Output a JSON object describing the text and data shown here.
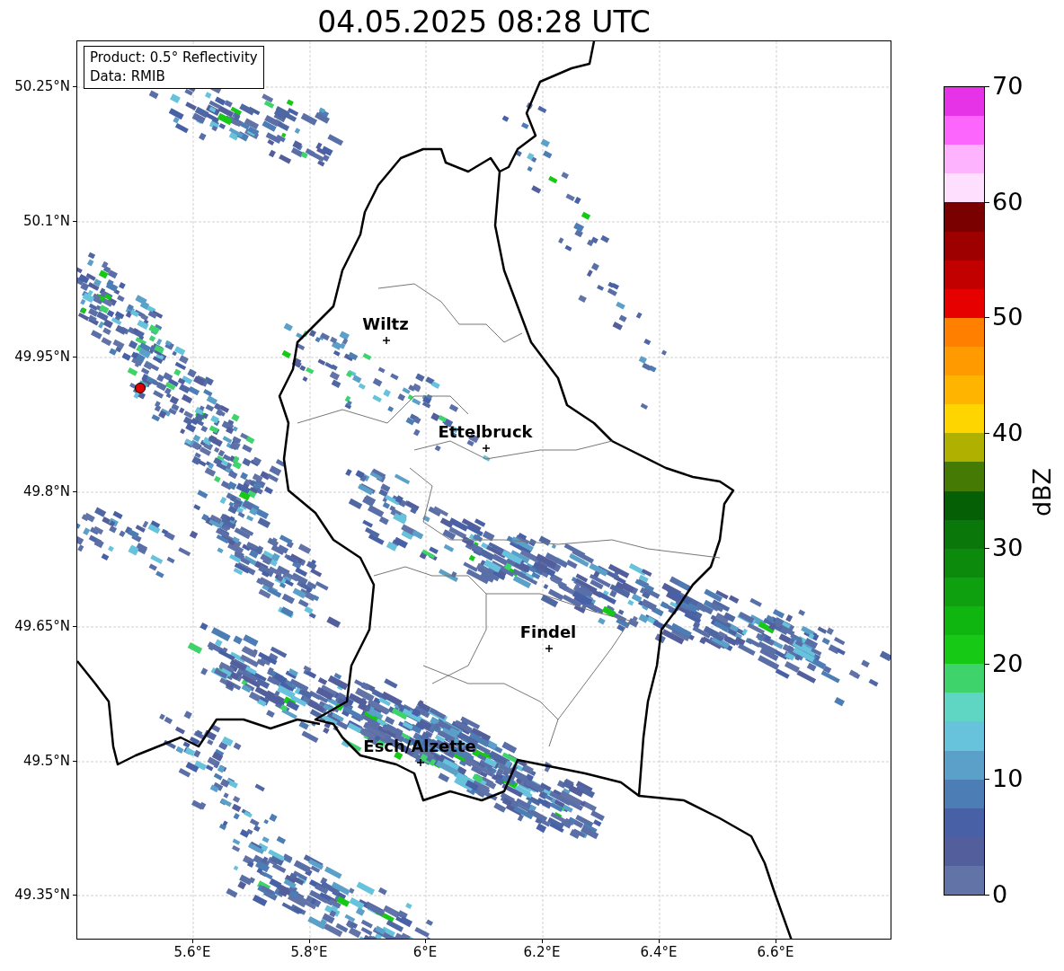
{
  "title": "04.05.2025 08:28 UTC",
  "info_box": [
    "Product: 0.5° Reflectivity",
    "Data: RMIB"
  ],
  "lat_labels": [
    "50.25°N",
    "50.1°N",
    "49.95°N",
    "49.8°N",
    "49.65°N",
    "49.5°N",
    "49.35°N"
  ],
  "lon_labels": [
    "5.6°E",
    "5.8°E",
    "6°E",
    "6.2°E",
    "6.4°E",
    "6.6°E"
  ],
  "cities": [
    {
      "name": "Wiltz"
    },
    {
      "name": "Ettelbruck"
    },
    {
      "name": "Findel"
    },
    {
      "name": "Esch/Alzette"
    }
  ],
  "colorbar": {
    "label": "dBZ",
    "ticks": [
      "70",
      "60",
      "50",
      "40",
      "30",
      "20",
      "10",
      "0"
    ],
    "segments": [
      {
        "color": "#e733e7"
      },
      {
        "color": "#fd66fd"
      },
      {
        "color": "#fdb3fd"
      },
      {
        "color": "#fee0fe"
      },
      {
        "color": "#7a0000"
      },
      {
        "color": "#9e0000"
      },
      {
        "color": "#c20000"
      },
      {
        "color": "#e60000"
      },
      {
        "color": "#ff7f00"
      },
      {
        "color": "#ff9a00"
      },
      {
        "color": "#ffb400"
      },
      {
        "color": "#ffd500"
      },
      {
        "color": "#b0b000"
      },
      {
        "color": "#457a05"
      },
      {
        "color": "#055f05"
      },
      {
        "color": "#0a770a"
      },
      {
        "color": "#0c8a0c"
      },
      {
        "color": "#0fa00f"
      },
      {
        "color": "#10b610"
      },
      {
        "color": "#15c915"
      },
      {
        "color": "#3ed46b"
      },
      {
        "color": "#5ed6c3"
      },
      {
        "color": "#67c2dc"
      },
      {
        "color": "#5ba0c9"
      },
      {
        "color": "#4c7db4"
      },
      {
        "color": "#4861a6"
      },
      {
        "color": "#535f9c"
      },
      {
        "color": "#6273a8"
      }
    ]
  }
}
